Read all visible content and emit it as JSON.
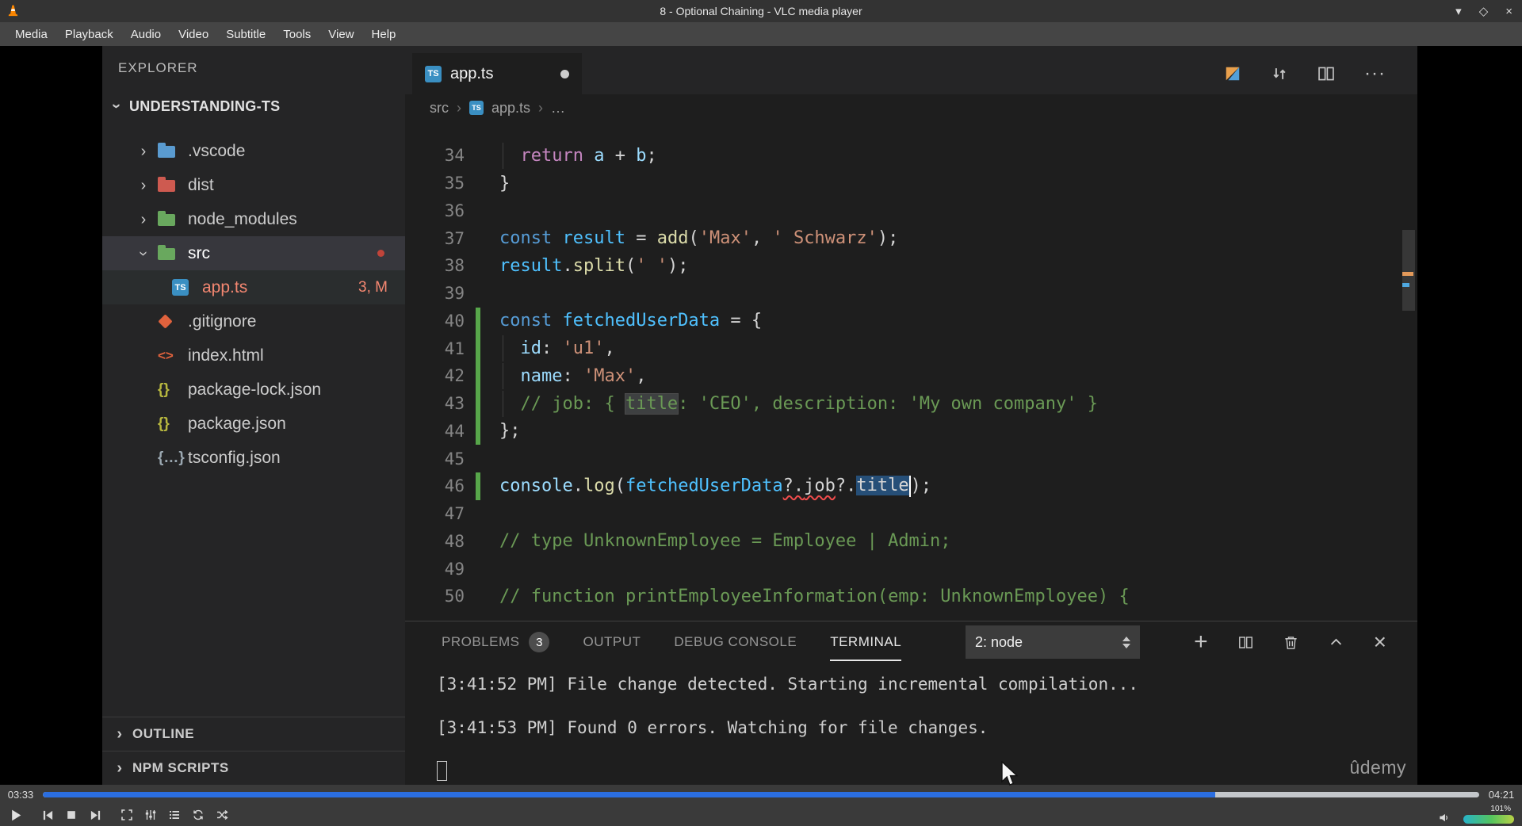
{
  "titlebar": {
    "title": "8 - Optional Chaining - VLC media player",
    "minimize": "▾",
    "maximize": "◇",
    "close": "×"
  },
  "menubar": {
    "items": [
      "Media",
      "Playback",
      "Audio",
      "Video",
      "Subtitle",
      "Tools",
      "View",
      "Help"
    ]
  },
  "explorer": {
    "header": "EXPLORER",
    "root": "UNDERSTANDING-TS",
    "items": [
      {
        "label": ".vscode",
        "icon": "folder",
        "color": "#5a9bd0",
        "expandable": true,
        "expanded": false
      },
      {
        "label": "dist",
        "icon": "folder",
        "color": "#ce5a50",
        "expandable": true,
        "expanded": false
      },
      {
        "label": "node_modules",
        "icon": "folder",
        "color": "#69a85e",
        "expandable": true,
        "expanded": false
      },
      {
        "label": "src",
        "icon": "folder",
        "color": "#69a85e",
        "expandable": true,
        "expanded": true,
        "selected": true,
        "dot": true
      },
      {
        "label": "app.ts",
        "icon": "ts",
        "indent": 1,
        "badge": "3, M",
        "error": true,
        "open": true
      },
      {
        "label": ".gitignore",
        "icon": "git"
      },
      {
        "label": "index.html",
        "icon": "html"
      },
      {
        "label": "package-lock.json",
        "icon": "json"
      },
      {
        "label": "package.json",
        "icon": "json"
      },
      {
        "label": "tsconfig.json",
        "icon": "jsonc"
      }
    ],
    "sections": [
      "OUTLINE",
      "NPM SCRIPTS"
    ]
  },
  "editor": {
    "tab": {
      "label": "app.ts"
    },
    "breadcrumb": {
      "folder": "src",
      "file": "app.ts",
      "more": "…"
    },
    "code": [
      {
        "n": 34,
        "guide": true,
        "t": [
          [
            "  ",
            "pl"
          ],
          [
            "return",
            "kw2"
          ],
          [
            " ",
            "pl"
          ],
          [
            "a",
            "var"
          ],
          [
            " + ",
            "op"
          ],
          [
            "b",
            "var"
          ],
          [
            ";",
            "op"
          ]
        ]
      },
      {
        "n": 35,
        "t": [
          [
            "}",
            "op"
          ]
        ]
      },
      {
        "n": 36,
        "t": []
      },
      {
        "n": 37,
        "t": [
          [
            "const",
            "kw"
          ],
          [
            " ",
            "pl"
          ],
          [
            "result",
            "cvar"
          ],
          [
            " = ",
            "op"
          ],
          [
            "add",
            "fn"
          ],
          [
            "(",
            "op"
          ],
          [
            "'Max'",
            "str"
          ],
          [
            ", ",
            "op"
          ],
          [
            "' Schwarz'",
            "str"
          ],
          [
            ");",
            "op"
          ]
        ]
      },
      {
        "n": 38,
        "t": [
          [
            "result",
            "cvar"
          ],
          [
            ".",
            "op"
          ],
          [
            "split",
            "fn"
          ],
          [
            "(",
            "op"
          ],
          [
            "' '",
            "str"
          ],
          [
            ");",
            "op"
          ]
        ]
      },
      {
        "n": 39,
        "t": []
      },
      {
        "n": 40,
        "git": true,
        "t": [
          [
            "const",
            "kw"
          ],
          [
            " ",
            "pl"
          ],
          [
            "fetchedUserData",
            "cvar"
          ],
          [
            " = {",
            "op"
          ]
        ]
      },
      {
        "n": 41,
        "git": true,
        "guide": true,
        "t": [
          [
            "  ",
            "pl"
          ],
          [
            "id",
            "var"
          ],
          [
            ": ",
            "op"
          ],
          [
            "'u1'",
            "str"
          ],
          [
            ",",
            "op"
          ]
        ]
      },
      {
        "n": 42,
        "git": true,
        "guide": true,
        "t": [
          [
            "  ",
            "pl"
          ],
          [
            "name",
            "var"
          ],
          [
            ": ",
            "op"
          ],
          [
            "'Max'",
            "str"
          ],
          [
            ",",
            "op"
          ]
        ]
      },
      {
        "n": 43,
        "git": true,
        "guide": true,
        "t": [
          [
            "  // job: { ",
            "cm"
          ],
          [
            "title",
            "cm hl"
          ],
          [
            ": 'CEO', description: 'My own company' }",
            "cm"
          ]
        ]
      },
      {
        "n": 44,
        "git": true,
        "t": [
          [
            "};",
            "op"
          ]
        ]
      },
      {
        "n": 45,
        "t": []
      },
      {
        "n": 46,
        "git": true,
        "t": [
          [
            "console",
            "var"
          ],
          [
            ".",
            "op"
          ],
          [
            "log",
            "fn"
          ],
          [
            "(",
            "op"
          ],
          [
            "fetchedUserData",
            "cvar"
          ],
          [
            "?.",
            "op err"
          ],
          [
            "job",
            "pl err"
          ],
          [
            "?.",
            "op"
          ],
          [
            "title",
            "pl sel"
          ],
          [
            "",
            "caret"
          ],
          [
            ");",
            "op"
          ]
        ]
      },
      {
        "n": 47,
        "t": []
      },
      {
        "n": 48,
        "t": [
          [
            "// type UnknownEmployee = Employee | Admin;",
            "cm"
          ]
        ]
      },
      {
        "n": 49,
        "t": []
      },
      {
        "n": 50,
        "t": [
          [
            "// function printEmployeeInformation(emp: UnknownEmployee) {",
            "cm"
          ]
        ]
      }
    ]
  },
  "panel": {
    "tabs": [
      {
        "label": "PROBLEMS",
        "badge": "3"
      },
      {
        "label": "OUTPUT"
      },
      {
        "label": "DEBUG CONSOLE"
      },
      {
        "label": "TERMINAL",
        "active": true
      }
    ],
    "shell_select": "2: node",
    "lines": [
      "[3:41:52 PM] File change detected. Starting incremental compilation...",
      "",
      "[3:41:53 PM] Found 0 errors. Watching for file changes.",
      ""
    ]
  },
  "watermark": "ûdemy",
  "player": {
    "elapsed": "03:33",
    "total": "04:21",
    "progress_pct": 81.6,
    "volume_pct": 101,
    "volume_label": "101%",
    "buttons": [
      "play",
      "previous",
      "stop",
      "next",
      "fullscreen",
      "extended-settings",
      "playlist",
      "loop",
      "random"
    ]
  }
}
